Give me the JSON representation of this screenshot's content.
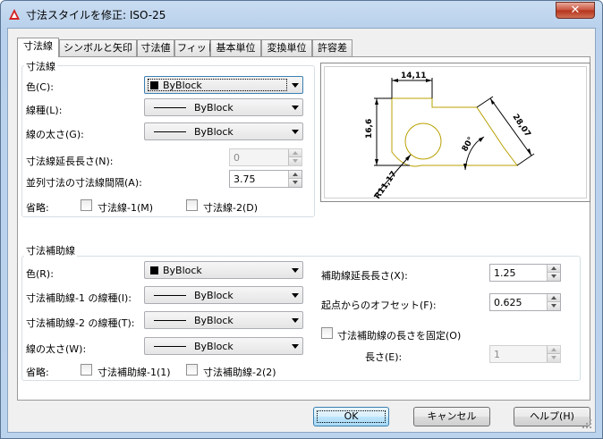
{
  "window": {
    "title": "寸法スタイルを修正: ISO-25",
    "close_label": "✕"
  },
  "tabs": [
    {
      "label": "寸法線"
    },
    {
      "label": "シンボルと矢印"
    },
    {
      "label": "寸法値"
    },
    {
      "label": "フィット"
    },
    {
      "label": "基本単位"
    },
    {
      "label": "変換単位"
    },
    {
      "label": "許容差"
    }
  ],
  "dim_lines": {
    "group_title": "寸法線",
    "color_label": "色(C):",
    "color_value": "ByBlock",
    "linetype_label": "線種(L):",
    "linetype_value": "ByBlock",
    "lineweight_label": "線の太さ(G):",
    "lineweight_value": "ByBlock",
    "extend_label": "寸法線延長長さ(N):",
    "extend_value": "0",
    "baseline_label": "並列寸法の寸法線間隔(A):",
    "baseline_value": "3.75",
    "suppress_label": "省略:",
    "suppress1_label": "寸法線-1(M)",
    "suppress2_label": "寸法線-2(D)"
  },
  "ext_lines": {
    "group_title": "寸法補助線",
    "color_label": "色(R):",
    "color_value": "ByBlock",
    "linetype1_label": "寸法補助線-1 の線種(I):",
    "linetype1_value": "ByBlock",
    "linetype2_label": "寸法補助線-2 の線種(T):",
    "linetype2_value": "ByBlock",
    "lineweight_label": "線の太さ(W):",
    "lineweight_value": "ByBlock",
    "suppress_label": "省略:",
    "suppress1_label": "寸法補助線-1(1)",
    "suppress2_label": "寸法補助線-2(2)",
    "extend_label": "補助線延長長さ(X):",
    "extend_value": "1.25",
    "offset_label": "起点からのオフセット(F):",
    "offset_value": "0.625",
    "fixed_label": "寸法補助線の長さを固定(O)",
    "length_label": "長さ(E):",
    "length_value": "1"
  },
  "preview": {
    "dim_top": "14,11",
    "dim_left": "16,6",
    "dim_diag": "28,07",
    "dim_angle": "80°",
    "dim_radius": "R11,17"
  },
  "buttons": {
    "ok": "OK",
    "cancel": "キャンセル",
    "help": "ヘルプ(H)"
  },
  "colors": {
    "geometry": "#b8a000",
    "dimension": "#000000"
  }
}
